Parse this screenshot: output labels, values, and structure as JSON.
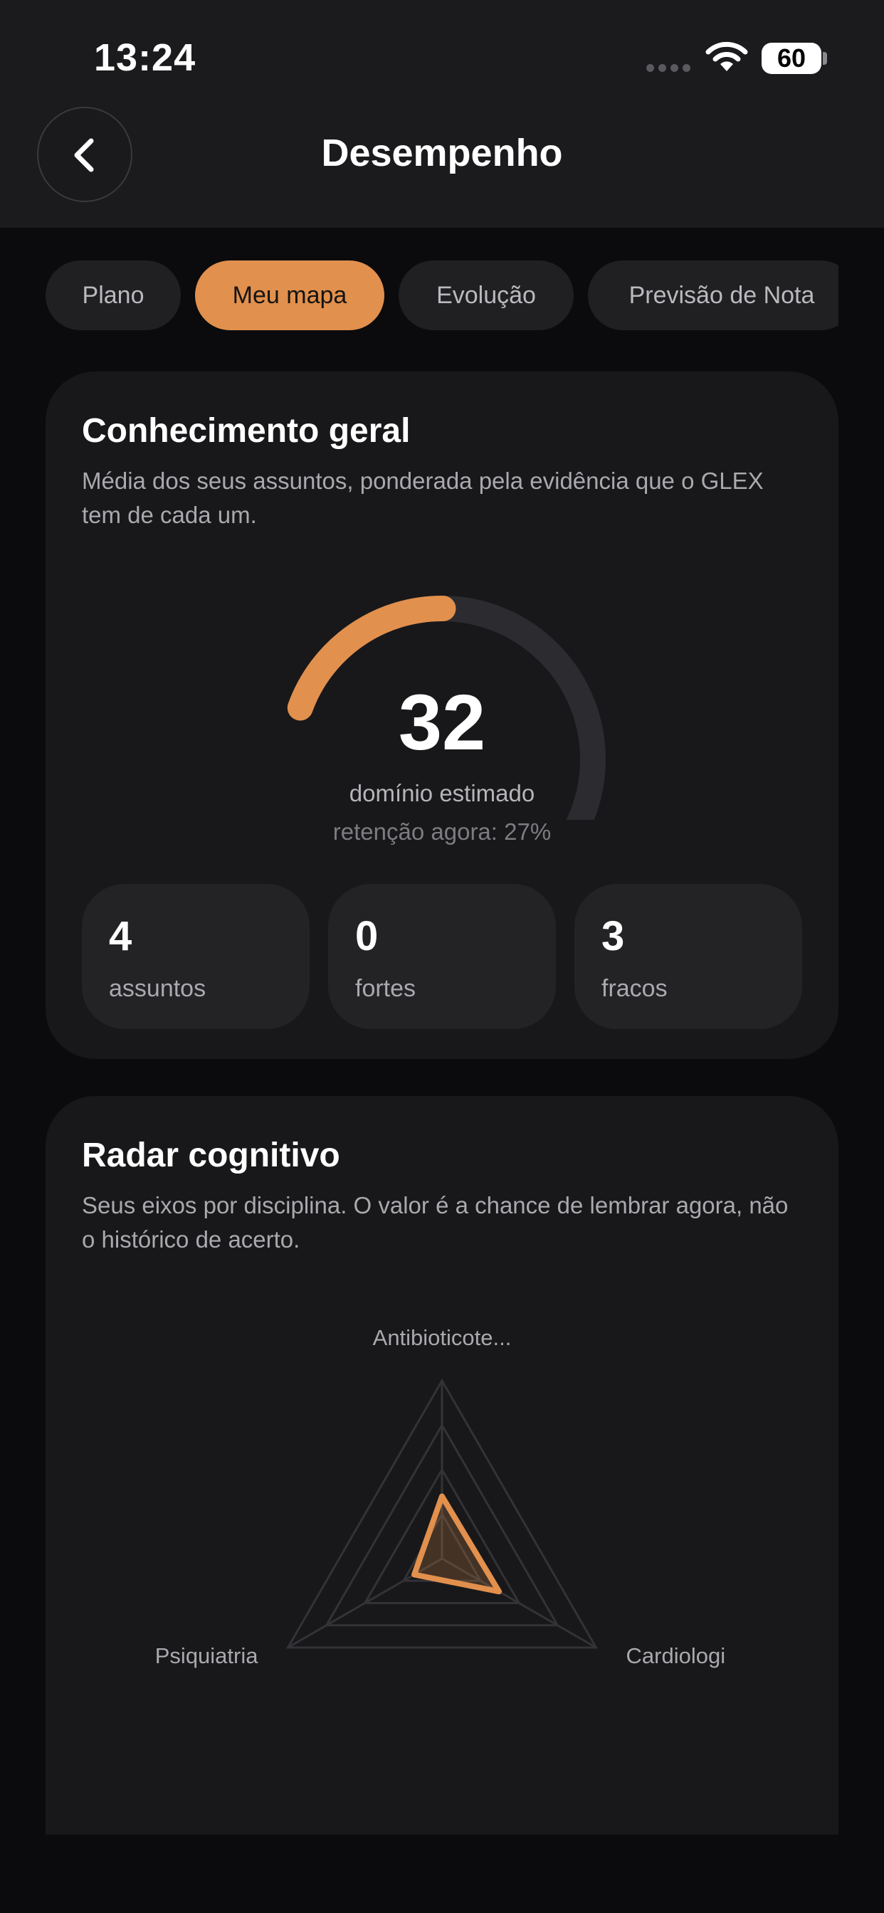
{
  "status_bar": {
    "time": "13:24",
    "battery": "60"
  },
  "header": {
    "title": "Desempenho"
  },
  "tabs": [
    {
      "label": "Plano",
      "active": false
    },
    {
      "label": "Meu mapa",
      "active": true
    },
    {
      "label": "Evolução",
      "active": false
    },
    {
      "label": "Previsão de Nota",
      "active": false
    }
  ],
  "knowledge": {
    "title": "Conhecimento geral",
    "description": "Média dos seus assuntos, ponderada pela evidência que o GLEX tem de cada um.",
    "gauge": {
      "value": "32",
      "fill_fraction": 0.32,
      "label": "domínio estimado",
      "retention": "retenção agora: 27%"
    },
    "stats": [
      {
        "value": "4",
        "label": "assuntos"
      },
      {
        "value": "0",
        "label": "fortes"
      },
      {
        "value": "3",
        "label": "fracos"
      }
    ]
  },
  "radar": {
    "title": "Radar cognitivo",
    "description": "Seus eixos por disciplina. O valor é a chance de lembrar agora, não o histórico de acerto.",
    "axes": [
      "Antibioticote...",
      "Cardiologi",
      "Psiquiatria"
    ],
    "values": [
      0.35,
      0.37,
      0.18
    ],
    "rings": 4
  },
  "colors": {
    "accent": "#e2904d",
    "card_bg": "#18181a",
    "page_bg": "#0b0b0d",
    "track": "#2c2c30"
  },
  "icons": {
    "back": "chevron-left-icon",
    "wifi": "wifi-icon",
    "signal": "cellular-signal-icon"
  }
}
